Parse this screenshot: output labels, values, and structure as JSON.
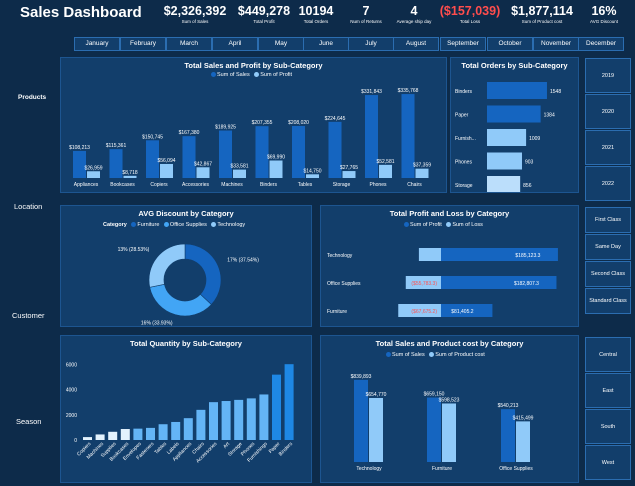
{
  "title": "Sales Dashboard",
  "kpis": [
    {
      "value": "$2,326,392",
      "label": "Sum of Sales",
      "color": "#ffffff"
    },
    {
      "value": "$449,278",
      "label": "Total Profit",
      "color": "#ffffff"
    },
    {
      "value": "10194",
      "label": "Total Orders",
      "color": "#ffffff"
    },
    {
      "value": "7",
      "label": "Num of Returns",
      "color": "#ffffff"
    },
    {
      "value": "4",
      "label": "Average ship day",
      "color": "#ffffff"
    },
    {
      "value": "($157,039)",
      "label": "Total Loss",
      "color": "#ff4d4d"
    },
    {
      "value": "$1,877,114",
      "label": "Sum of Product cost",
      "color": "#ffffff"
    },
    {
      "value": "16%",
      "label": "AVG Discount",
      "color": "#ffffff"
    }
  ],
  "months": [
    "January",
    "February",
    "March",
    "April",
    "May",
    "June",
    "July",
    "August",
    "September",
    "October",
    "November",
    "December"
  ],
  "row_labels": {
    "products": "Products",
    "location": "Location",
    "customer": "Customer",
    "season": "Season"
  },
  "years": [
    "2019",
    "2020",
    "2021",
    "2022"
  ],
  "segments": [
    "First Class",
    "Same Day",
    "Second Class",
    "Standard Class"
  ],
  "regions": [
    "Central",
    "East",
    "South",
    "West"
  ],
  "colors": {
    "dark_bar": "#1565c0",
    "light_bar": "#90caf9",
    "mid_bar": "#1e88e5",
    "loss": "#ff5252",
    "panel": "#123e6b",
    "bg": "#0d2b4a"
  },
  "chart_data": [
    {
      "id": "sales_profit_subcat",
      "type": "bar",
      "title": "Total Sales and Profit by Sub-Category",
      "categories": [
        "Appliances",
        "Bookcases",
        "Copiers",
        "Accessories",
        "Machines",
        "Binders",
        "Tables",
        "Storage",
        "Phones",
        "Chairs"
      ],
      "series": [
        {
          "name": "Sum of Sales",
          "values": [
            108213,
            115361,
            150745,
            167380,
            189925,
            207355,
            208020,
            224645,
            331843,
            335768
          ],
          "labels": [
            "$108,213",
            "$115,361",
            "$150,745",
            "$167,380",
            "$189,925",
            "$207,355",
            "$208,020",
            "$224,645",
            "$331,843",
            "$335,768"
          ]
        },
        {
          "name": "Sum of Profit",
          "values": [
            26959,
            8718,
            56094,
            42867,
            33581,
            69990,
            14750,
            27765,
            52581,
            37359
          ],
          "labels": [
            "$26,959",
            "$8,718",
            "$56,094",
            "$42,867",
            "$33,581",
            "$69,990",
            "$14,750",
            "$27,765",
            "$52,581",
            "$37,359"
          ]
        }
      ],
      "ylim": [
        0,
        360000
      ]
    },
    {
      "id": "orders_subcat",
      "type": "bar",
      "title": "Total Orders by Sub-Category",
      "orientation": "horizontal",
      "categories": [
        "Binders",
        "Paper",
        "Furnish...",
        "Phones",
        "Storage"
      ],
      "values": [
        1548,
        1384,
        1009,
        903,
        856
      ],
      "xlim": [
        0,
        1600
      ]
    },
    {
      "id": "avg_discount",
      "type": "pie",
      "title": "AVG Discount by Category",
      "legend_title": "Category",
      "categories": [
        "Furniture",
        "Office Supplies",
        "Technology"
      ],
      "values": [
        17,
        16,
        13
      ],
      "labels": [
        "17% (37.54%)",
        "16% (33.93%)",
        "13% (28.53%)"
      ],
      "colors": [
        "#1565c0",
        "#42a5f5",
        "#90caf9"
      ]
    },
    {
      "id": "profit_loss_cat",
      "type": "bar",
      "title": "Total Profit and Loss by Category",
      "orientation": "horizontal",
      "categories": [
        "Technology",
        "Office Supplies",
        "Furniture"
      ],
      "series": [
        {
          "name": "Sum of Profit",
          "values": [
            185123.3,
            182807.3,
            81405.2
          ],
          "labels": [
            "$185,123.3",
            "$182,807.3",
            "$81,405.2"
          ]
        },
        {
          "name": "Sum of Loss",
          "values": [
            -35000,
            -55783.3,
            -67675.2
          ],
          "labels": [
            "",
            "($55,783.3)",
            "($67,675.2)"
          ]
        }
      ]
    },
    {
      "id": "quantity_subcat",
      "type": "bar",
      "title": "Total Quantity by Sub-Category",
      "categories": [
        "Copiers",
        "Machines",
        "Supplies",
        "Bookcases",
        "Envelopes",
        "Fasteners",
        "Tables",
        "Labels",
        "Appliances",
        "Chairs",
        "Accessories",
        "Art",
        "Storage",
        "Phones",
        "Furnishings",
        "Paper",
        "Binders"
      ],
      "values": [
        230,
        440,
        650,
        870,
        900,
        960,
        1250,
        1430,
        1730,
        2390,
        3000,
        3090,
        3180,
        3300,
        3610,
        5180,
        6010
      ],
      "yticks": [
        0,
        2000,
        4000,
        6000
      ],
      "ylim": [
        0,
        6500
      ]
    },
    {
      "id": "sales_cost_cat",
      "type": "bar",
      "title": "Total Sales and Product cost by Category",
      "categories": [
        "Technology",
        "Furniture",
        "Office Supplies"
      ],
      "series": [
        {
          "name": "Sum of Sales",
          "values": [
            839893,
            659150,
            540213
          ],
          "labels": [
            "$839,893",
            "$659,150",
            "$540,213"
          ]
        },
        {
          "name": "Sum of Product cost",
          "values": [
            654770,
            598523,
            415499
          ],
          "labels": [
            "$654,770",
            "$598,523",
            "$415,499"
          ]
        }
      ],
      "ylim": [
        0,
        900000
      ]
    }
  ]
}
